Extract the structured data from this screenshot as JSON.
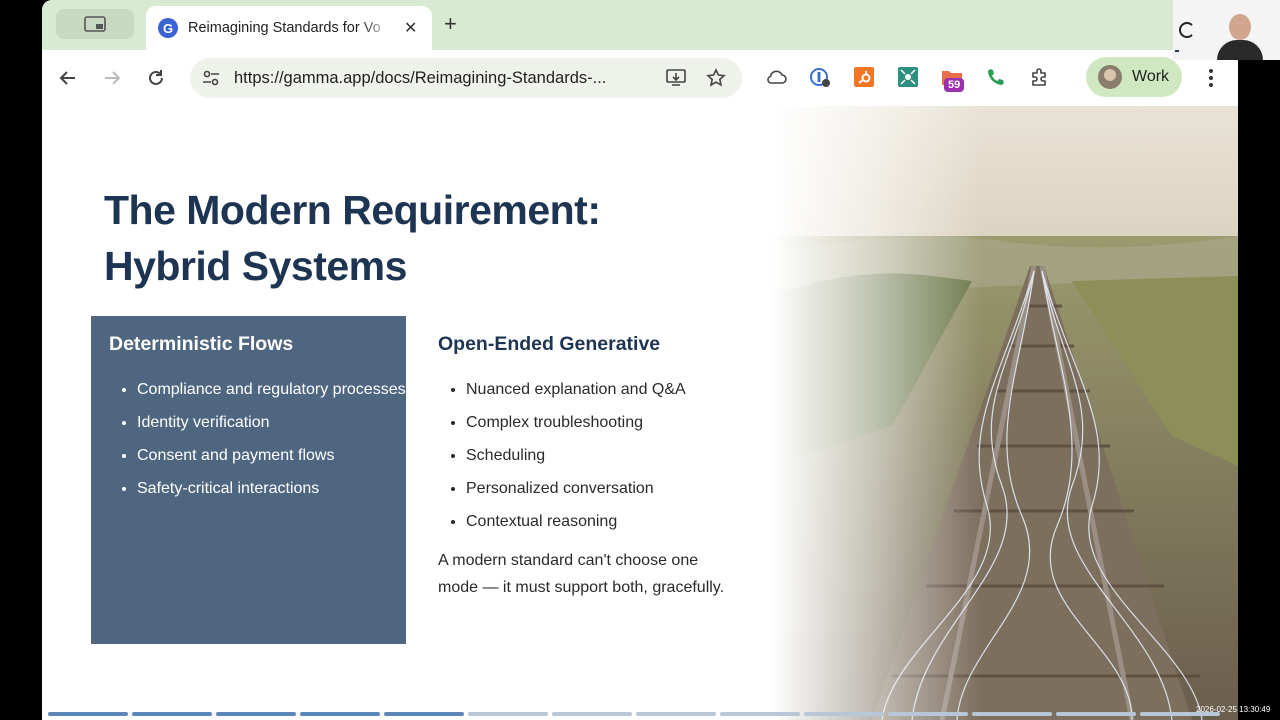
{
  "browser": {
    "tab": {
      "title": "Reimagining Standards for Vo"
    },
    "address_bar": {
      "url_host": "https://gamma.app",
      "url_path": "/docs/Reimagining-Standards-..."
    },
    "profile": {
      "label": "Work"
    },
    "extension_badge": "59"
  },
  "slide": {
    "heading_line1": "The Modern Requirement:",
    "heading_line2": "Hybrid Systems",
    "deterministic": {
      "title": "Deterministic Flows",
      "items": [
        "Compliance and regulatory processes",
        "Identity verification",
        "Consent and payment flows",
        "Safety-critical interactions"
      ]
    },
    "generative": {
      "title": "Open-Ended Generative",
      "items": [
        "Nuanced explanation and Q&A",
        "Complex troubleshooting",
        "Scheduling",
        "Personalized conversation",
        "Contextual reasoning"
      ]
    },
    "note": "A modern standard can't choose one mode — it must support both, gracefully."
  },
  "overlay": {
    "timestamp": "2026-02-25 13:30:49"
  },
  "colors": {
    "heading": "#1d3552",
    "card": "#4f6680",
    "tabstrip": "#d9ead2",
    "profile": "#cfe8c1"
  }
}
